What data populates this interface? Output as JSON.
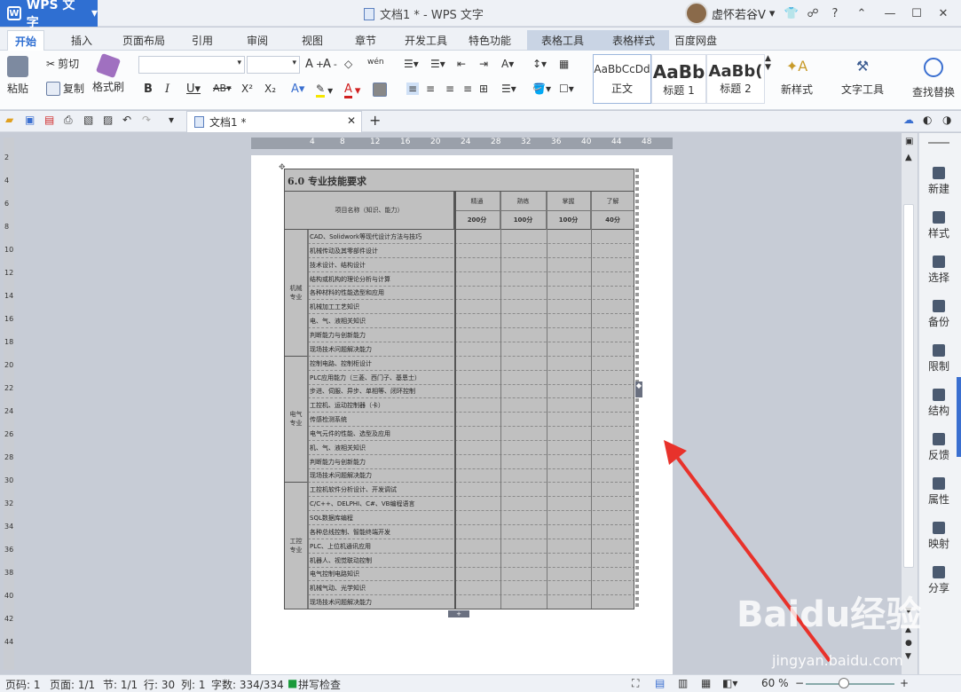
{
  "app": {
    "name": "WPS 文字",
    "window_title": "文档1 * - WPS 文字",
    "user": "虚怀若谷V",
    "help": "?"
  },
  "menu_tabs": [
    "开始",
    "插入",
    "页面布局",
    "引用",
    "审阅",
    "视图",
    "章节",
    "开发工具",
    "特色功能",
    "表格工具",
    "表格样式",
    "百度网盘"
  ],
  "ribbon": {
    "paste": "粘贴",
    "cut": "剪切",
    "copy": "复制",
    "format_painter": "格式刷",
    "styles": [
      {
        "preview": "AaBbCcDd",
        "label": "正文"
      },
      {
        "preview": "AaBb",
        "label": "标题 1"
      },
      {
        "preview": "AaBb(",
        "label": "标题 2"
      }
    ],
    "new_style": "新样式",
    "text_tools": "文字工具",
    "find_replace": "查找替换"
  },
  "document_tab": {
    "label": "文档1 *"
  },
  "ruler": {
    "h_ticks": [
      "4",
      "8",
      "12",
      "16",
      "20",
      "24",
      "28",
      "32",
      "36",
      "40",
      "44",
      "48"
    ],
    "v_ticks": [
      "2",
      "4",
      "6",
      "8",
      "10",
      "12",
      "14",
      "16",
      "18",
      "20",
      "22",
      "24",
      "26",
      "28",
      "30",
      "32",
      "34",
      "36",
      "38",
      "40",
      "42",
      "44"
    ]
  },
  "table": {
    "title": "6.0 专业技能要求",
    "header_item": "项目名称（知识、能力）",
    "levels": [
      {
        "name": "精通",
        "score": "200分"
      },
      {
        "name": "熟练",
        "score": "100分"
      },
      {
        "name": "掌握",
        "score": "100分"
      },
      {
        "name": "了解",
        "score": "40分"
      }
    ],
    "groups": [
      {
        "name": "机械专业",
        "items": [
          "CAD、Solidwork等现代设计方法与技巧",
          "机械传动及其零部件设计",
          "技术设计、结构设计",
          "结构或机构的理论分析与计算",
          "各种材料的性能选型和应用",
          "机械加工工艺知识",
          "电、气、液相关知识",
          "判断能力与创新能力",
          "现场技术问题解决能力"
        ]
      },
      {
        "name": "电气专业",
        "items": [
          "控制电路、控制柜设计",
          "PLC应用能力（三菱、西门子、基恩士）",
          "步进、伺服、异步、单相等、闭环控制",
          "工控机、运动控制器（卡）",
          "传感检测系统",
          "电气元件的性能、选型及应用",
          "机、气、液相关知识",
          "判断能力与创新能力",
          "现场技术问题解决能力"
        ]
      },
      {
        "name": "工控专业",
        "items": [
          "工控机软件分析设计、开发调试",
          "C/C++、DELPHI、C#、VB编程语言",
          "SQL数据库编程",
          "各种总线控制、智能终端开发",
          "PLC、上位机通讯应用",
          "机器人、视觉联动控制",
          "电气控制电路知识",
          "机械气动、光学知识",
          "现场技术问题解决能力"
        ]
      }
    ]
  },
  "sidebar": [
    "新建",
    "样式",
    "选择",
    "备份",
    "限制",
    "结构",
    "反馈",
    "属性",
    "映射",
    "分享"
  ],
  "status": {
    "page": "页码: 1",
    "pages": "页面: 1/1",
    "section": "节: 1/1",
    "line": "行: 30",
    "col": "列: 1",
    "words": "字数: 334/334",
    "spell": "拼写检查",
    "zoom": "60 %"
  },
  "watermark": {
    "brand": "Baidu经验",
    "url": "jingyan.baidu.com"
  },
  "colors": {
    "accent": "#2f6fd2",
    "arrow": "#e8322b"
  }
}
